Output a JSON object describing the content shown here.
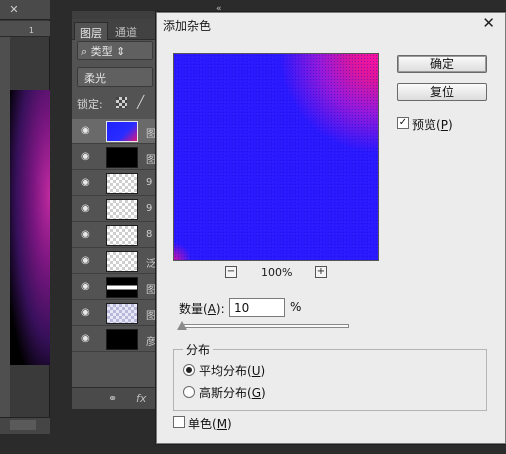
{
  "canvas": {
    "close_glyph": "✕",
    "ruler_mark": "1"
  },
  "layers_panel": {
    "collapse_glyph": "«",
    "tabs": [
      {
        "label": "图层"
      },
      {
        "label": "通道"
      }
    ],
    "filter": {
      "icon": "search-icon",
      "label": "类型"
    },
    "blend_mode": "柔光",
    "lock_label": "锁定:",
    "rows": [
      {
        "thumb": "blue",
        "selected": true,
        "tail": "图"
      },
      {
        "thumb": "black",
        "tail": "图"
      },
      {
        "thumb": "checker",
        "tail": "9"
      },
      {
        "thumb": "checker",
        "tail": "9"
      },
      {
        "thumb": "checker",
        "tail": "8"
      },
      {
        "thumb": "checker",
        "tail": "泛"
      },
      {
        "thumb": "bar",
        "tail": "图"
      },
      {
        "thumb": "faint",
        "tail": "图"
      },
      {
        "thumb": "black",
        "tail": "彦"
      }
    ],
    "footer": {
      "link_icon": "link-icon",
      "fx": "fx"
    }
  },
  "dialog": {
    "title": "添加杂色",
    "close_glyph": "✕",
    "ok_label": "确定",
    "reset_label": "复位",
    "preview_checkbox": {
      "label_pre": "预览(",
      "mnemonic": "P",
      "label_post": ")",
      "checked": true
    },
    "zoom": {
      "minus": "−",
      "value": "100%",
      "plus": "+"
    },
    "amount": {
      "label_pre": "数量(",
      "mnemonic": "A",
      "label_post": "):",
      "value": "10",
      "unit": "%"
    },
    "distribution": {
      "title": "分布",
      "uniform": {
        "label_pre": "平均分布(",
        "mnemonic": "U",
        "label_post": ")",
        "checked": true
      },
      "gaussian": {
        "label_pre": "高斯分布(",
        "mnemonic": "G",
        "label_post": ")",
        "checked": false
      }
    },
    "monochrome": {
      "label_pre": "单色(",
      "mnemonic": "M",
      "label_post": ")",
      "checked": false
    }
  }
}
